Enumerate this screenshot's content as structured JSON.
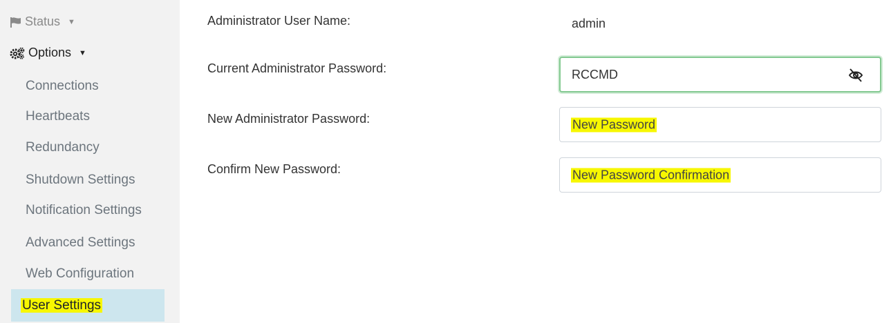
{
  "sidebar": {
    "status_label": "Status",
    "options_label": "Options",
    "items": [
      {
        "label": "Connections"
      },
      {
        "label": "Heartbeats"
      },
      {
        "label": "Redundancy"
      },
      {
        "label": "Shutdown Settings"
      },
      {
        "label": "Notification Settings"
      },
      {
        "label": "Advanced Settings"
      },
      {
        "label": "Web Configuration"
      },
      {
        "label": "User Settings",
        "active": true
      }
    ]
  },
  "form": {
    "admin_user_label": "Administrator User Name:",
    "admin_user_value": "admin",
    "current_password_label": "Current Administrator Password:",
    "current_password_value": "RCCMD",
    "new_password_label": "New Administrator Password:",
    "new_password_placeholder": "New Password",
    "confirm_password_label": "Confirm New Password:",
    "confirm_password_placeholder": "New Password Confirmation"
  },
  "colors": {
    "sidebar_bg": "#f2f2f2",
    "active_item_bg": "#cde6ee",
    "highlight": "#f7f700",
    "focus_border": "#82c990"
  },
  "icons": {
    "status": "flag-icon",
    "options": "gears-icon",
    "caret": "caret-down-icon",
    "password_toggle": "eye-slash-icon"
  }
}
